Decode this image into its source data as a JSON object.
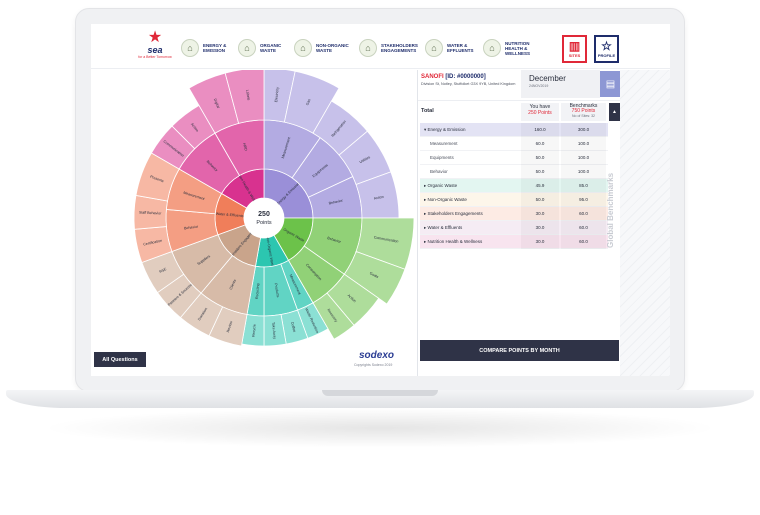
{
  "logo": {
    "brand": "sea",
    "tagline": "for a Better Tomorrow"
  },
  "nav": {
    "items": [
      {
        "label": "ENERGY & EMISSION",
        "icon": "energy-icon"
      },
      {
        "label": "ORGANIC WASTE",
        "icon": "organic-waste-icon"
      },
      {
        "label": "NON-ORGANIC WASTE",
        "icon": "non-organic-waste-icon"
      },
      {
        "label": "STAKEHOLDERS ENGAGEMENTS",
        "icon": "stakeholders-icon"
      },
      {
        "label": "WATER & EFFLUENTS",
        "icon": "water-icon"
      },
      {
        "label": "NUTRITION HEALTH & WELLNESS",
        "icon": "nutrition-icon"
      }
    ],
    "sites_label": "SITES",
    "profile_label": "PROFILE"
  },
  "chart": {
    "center_value": "250",
    "center_label": "Points",
    "all_questions_label": "All Questions",
    "brand": "sodexo",
    "copyright": "Copyrights Sodexo 2019"
  },
  "site": {
    "name": "SANOFI",
    "id": "[ID: #0000000]",
    "address": "Division St, Notley, Stuffolket G3X 9YB, United Kingdom"
  },
  "date": {
    "month": "December",
    "date": "24NOV2019"
  },
  "table": {
    "total_label": "Total",
    "you_have_label": "You have",
    "you_have_value": "250 Points",
    "benchmarks_label": "Benchmarks",
    "benchmarks_value": "750 Points",
    "benchmarks_note": "No of Sites: 32",
    "rows": [
      {
        "label": "Energy & Emission",
        "you": "160.0",
        "bench": "300.0",
        "type": "group-open",
        "color": "#e3e3f4"
      },
      {
        "label": "Measurement",
        "you": "60.0",
        "bench": "100.0",
        "type": "sub",
        "color": "#ffffff"
      },
      {
        "label": "Equipments",
        "you": "50.0",
        "bench": "100.0",
        "type": "sub",
        "color": "#ffffff"
      },
      {
        "label": "Behavior",
        "you": "50.0",
        "bench": "100.0",
        "type": "sub",
        "color": "#ffffff"
      },
      {
        "label": "Organic Waste",
        "you": "45.9",
        "bench": "85.0",
        "type": "group",
        "color": "#e3f6f1"
      },
      {
        "label": "Non-Organic Waste",
        "you": "50.0",
        "bench": "95.0",
        "type": "group",
        "color": "#fdf6ea"
      },
      {
        "label": "Stakeholders Engagements",
        "you": "30.0",
        "bench": "60.0",
        "type": "group",
        "color": "#fdebe4"
      },
      {
        "label": "Water & Effluents",
        "you": "30.0",
        "bench": "60.0",
        "type": "group",
        "color": "#f5ecf4"
      },
      {
        "label": "Nutrition Health & Wellness",
        "you": "30.0",
        "bench": "60.0",
        "type": "group",
        "color": "#f8e4ef"
      }
    ]
  },
  "global_benchmarks_label": "Global Benchmarks",
  "compare_label": "COMPARE POINTS BY MONTH",
  "sunburst": {
    "inner": [
      {
        "label": "Energy & Emission",
        "color": "#9a8fd8"
      },
      {
        "label": "Organic Waste",
        "color": "#6cc24a"
      },
      {
        "label": "Non-Organic Waste",
        "color": "#2cc6b0"
      },
      {
        "label": "Stakeholders Engagements",
        "color": "#c9a48b"
      },
      {
        "label": "Water & Effluents",
        "color": "#f07e5a"
      },
      {
        "label": "Nutrition Health & Wellness",
        "color": "#d8328f"
      }
    ],
    "middle": [
      {
        "label": "Measurement"
      },
      {
        "label": "Equipments"
      },
      {
        "label": "Behavior"
      },
      {
        "label": "Behavior"
      },
      {
        "label": "Consumption"
      },
      {
        "label": "Measurement"
      },
      {
        "label": "Products"
      },
      {
        "label": "Recycling"
      },
      {
        "label": "Clients"
      },
      {
        "label": "Suppliers"
      },
      {
        "label": "Behavior"
      },
      {
        "label": "Measurement"
      },
      {
        "label": "Behavior"
      },
      {
        "label": "HRD"
      }
    ],
    "outer": [
      {
        "label": "Electricity"
      },
      {
        "label": "Gas"
      },
      {
        "label": "Refrigeration"
      },
      {
        "label": "Utilities"
      },
      {
        "label": "Action"
      },
      {
        "label": "Communication"
      },
      {
        "label": "Goals"
      },
      {
        "label": "Action"
      },
      {
        "label": "Recovery"
      },
      {
        "label": "Waste Reduction"
      },
      {
        "label": "Coffee"
      },
      {
        "label": "Take Away"
      },
      {
        "label": "Recycle"
      },
      {
        "label": "Review"
      },
      {
        "label": "Donation"
      },
      {
        "label": "Partners & Sources"
      },
      {
        "label": "RSE"
      },
      {
        "label": "Certification"
      },
      {
        "label": "Staff Behavior"
      },
      {
        "label": "Presents"
      },
      {
        "label": "Communication"
      },
      {
        "label": "Action"
      },
      {
        "label": "Digital"
      },
      {
        "label": "Labels"
      },
      {
        "label": "Food"
      },
      {
        "label": "Ranking"
      }
    ]
  }
}
